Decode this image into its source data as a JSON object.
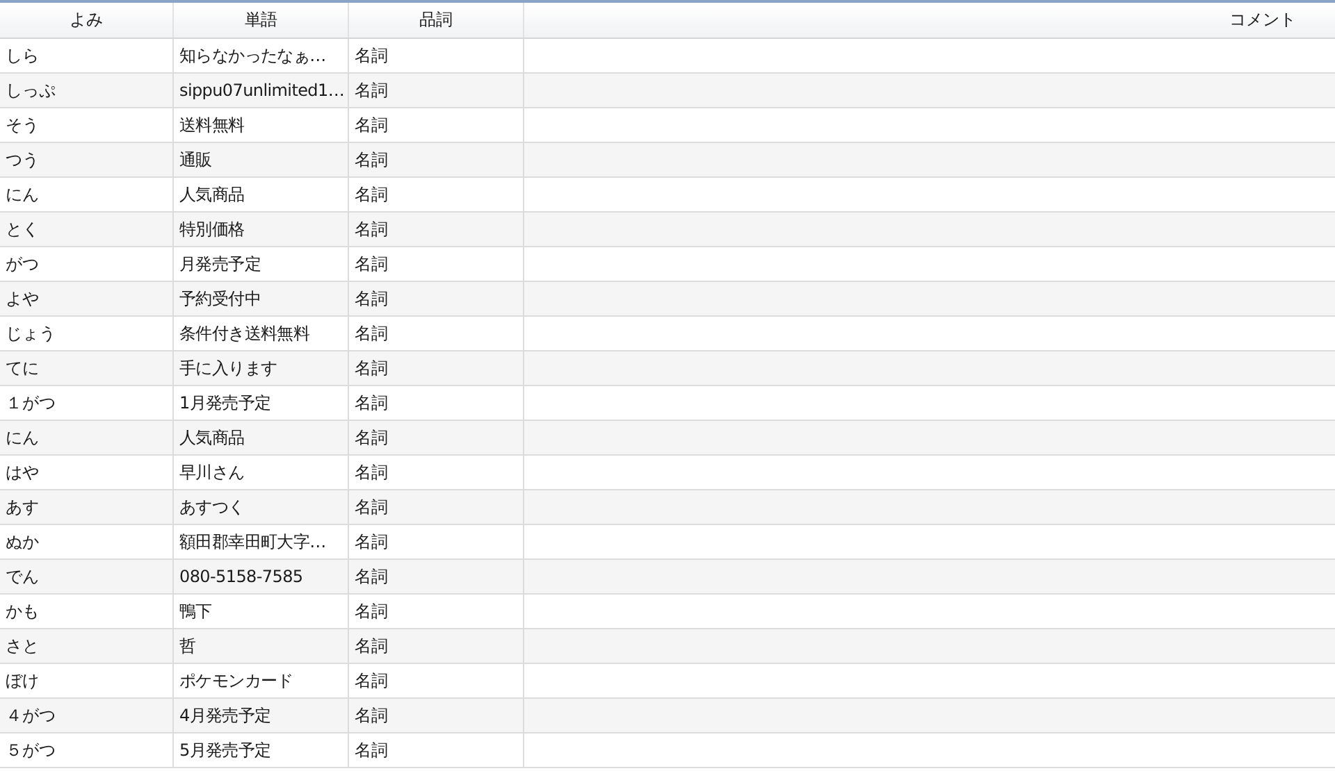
{
  "table": {
    "columns": [
      "よみ",
      "単語",
      "品詞",
      "コメント"
    ],
    "rows": [
      [
        "しら",
        "知らなかったなぁ…",
        "名詞"
      ],
      [
        "しっぷ",
        "sippu07unlimited1…",
        "名詞"
      ],
      [
        "そう",
        "送料無料",
        "名詞"
      ],
      [
        "つう",
        "通販",
        "名詞"
      ],
      [
        "にん",
        "人気商品",
        "名詞"
      ],
      [
        "とく",
        "特別価格",
        "名詞"
      ],
      [
        "がつ",
        "月発売予定",
        "名詞"
      ],
      [
        "よや",
        "予約受付中",
        "名詞"
      ],
      [
        "じょう",
        "条件付き送料無料",
        "名詞"
      ],
      [
        "てに",
        "手に入ります",
        "名詞"
      ],
      [
        "１がつ",
        "1月発売予定",
        "名詞"
      ],
      [
        "にん",
        "人気商品",
        "名詞"
      ],
      [
        "はや",
        "早川さん",
        "名詞"
      ],
      [
        "あす",
        "あすつく",
        "名詞"
      ],
      [
        "ぬか",
        "額田郡幸田町大字…",
        "名詞"
      ],
      [
        "でん",
        "080-5158-7585",
        "名詞"
      ],
      [
        "かも",
        "鴨下",
        "名詞"
      ],
      [
        "さと",
        "哲",
        "名詞"
      ],
      [
        "ぼけ",
        "ポケモンカード",
        "名詞"
      ],
      [
        "４がつ",
        "4月発売予定",
        "名詞"
      ],
      [
        "５がつ",
        "5月発売予定",
        "名詞"
      ]
    ]
  }
}
